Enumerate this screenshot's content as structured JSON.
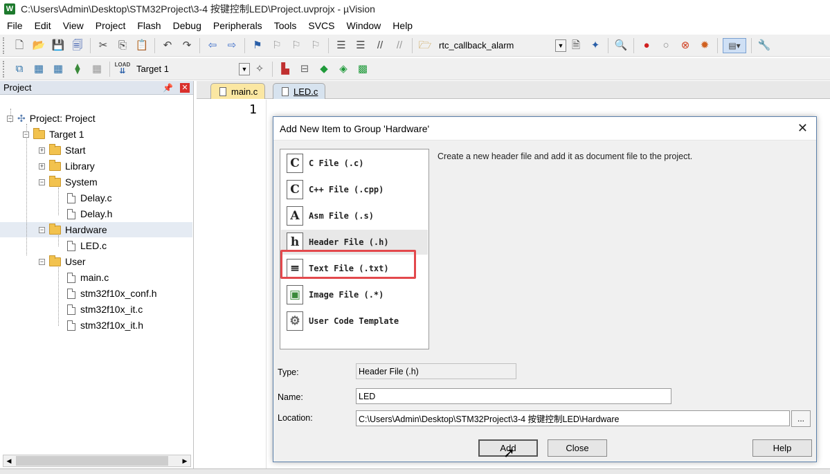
{
  "window": {
    "title": "C:\\Users\\Admin\\Desktop\\STM32Project\\3-4 按键控制LED\\Project.uvprojx - µVision",
    "app_icon": "W"
  },
  "menu": [
    "File",
    "Edit",
    "View",
    "Project",
    "Flash",
    "Debug",
    "Peripherals",
    "Tools",
    "SVCS",
    "Window",
    "Help"
  ],
  "toolbar1": {
    "function_combo": "rtc_callback_alarm"
  },
  "toolbar2": {
    "target_combo": "Target 1",
    "load_label": "LOAD"
  },
  "project_panel": {
    "title": "Project",
    "tree": [
      {
        "label": "Project: Project"
      },
      {
        "label": "Target 1"
      },
      {
        "label": "Start"
      },
      {
        "label": "Library"
      },
      {
        "label": "System"
      },
      {
        "label": "Delay.c"
      },
      {
        "label": "Delay.h"
      },
      {
        "label": "Hardware"
      },
      {
        "label": "LED.c"
      },
      {
        "label": "User"
      },
      {
        "label": "main.c"
      },
      {
        "label": "stm32f10x_conf.h"
      },
      {
        "label": "stm32f10x_it.c"
      },
      {
        "label": "stm32f10x_it.h"
      }
    ]
  },
  "editor": {
    "tabs": [
      "main.c",
      "LED.c"
    ],
    "active_tab": "LED.c",
    "line_number": "1"
  },
  "dialog": {
    "title": "Add New Item to Group 'Hardware'",
    "items": [
      {
        "icon": "C",
        "label": "C File (.c)"
      },
      {
        "icon": "C",
        "label": "C++ File (.cpp)"
      },
      {
        "icon": "A",
        "label": "Asm File (.s)"
      },
      {
        "icon": "h",
        "label": "Header File (.h)"
      },
      {
        "icon": "≡",
        "label": "Text File (.txt)"
      },
      {
        "icon": "▣",
        "label": "Image File (.*)"
      },
      {
        "icon": "⚙",
        "label": "User Code Template"
      }
    ],
    "selected_item": "Header File (.h)",
    "description": "Create a new header file and add it as document file to the project.",
    "type_label": "Type:",
    "type_value": "Header File (.h)",
    "name_label": "Name:",
    "name_value": "LED",
    "location_label": "Location:",
    "location_value": "C:\\Users\\Admin\\Desktop\\STM32Project\\3-4 按键控制LED\\Hardware",
    "browse_label": "...",
    "add_label": "Add",
    "close_label": "Close",
    "help_label": "Help"
  },
  "colors": {
    "highlight_box": "#e3484c",
    "tab_active": "#d7e3ef",
    "tab_inactive": "#fbe7a2"
  }
}
